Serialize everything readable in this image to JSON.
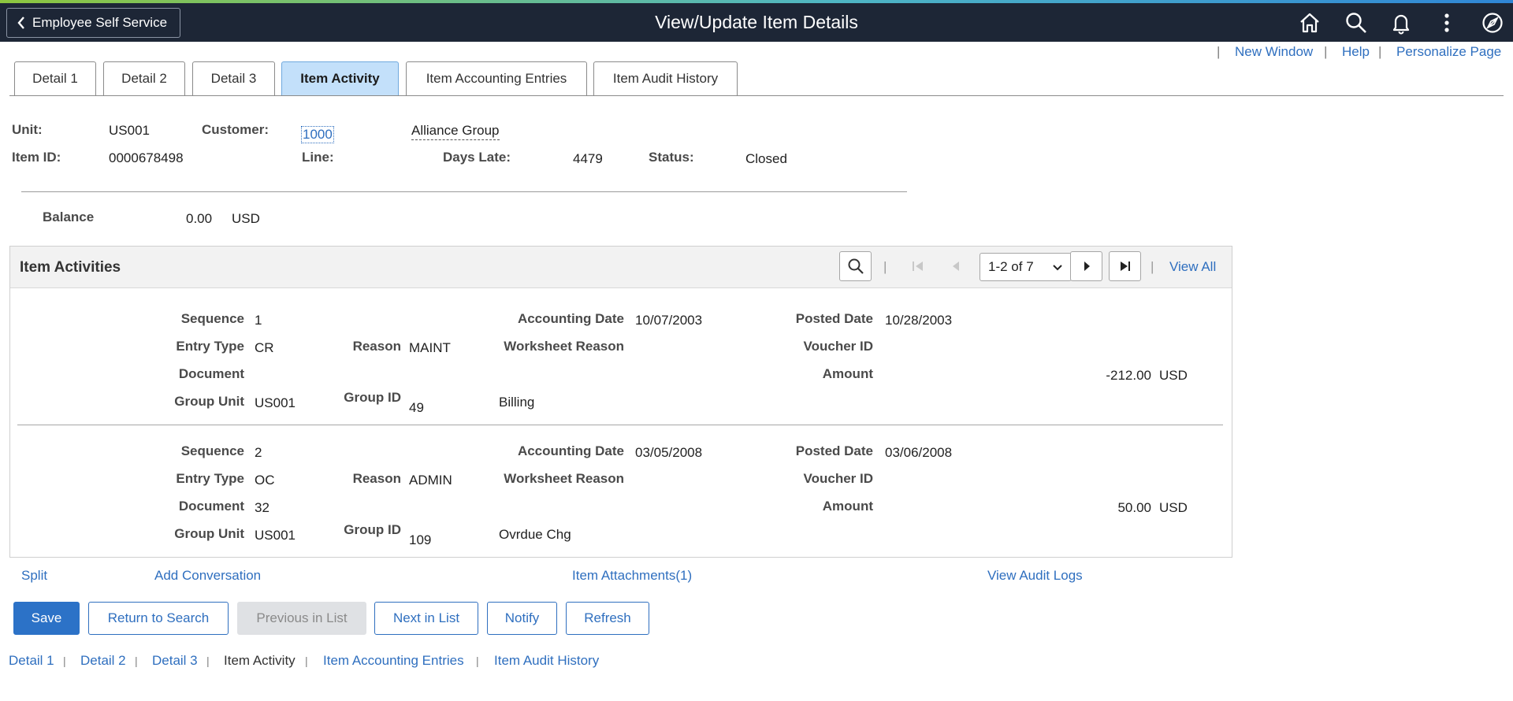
{
  "header": {
    "back_label": "Employee Self Service",
    "title": "View/Update Item Details",
    "icons": [
      "home-icon",
      "search-icon",
      "bell-icon",
      "more-icon",
      "navigator-icon"
    ]
  },
  "utility_links": {
    "new_window": "New Window",
    "help": "Help",
    "personalize": "Personalize Page",
    "separator": "|"
  },
  "tabs": [
    {
      "label": "Detail 1"
    },
    {
      "label": "Detail 2"
    },
    {
      "label": "Detail 3"
    },
    {
      "label": "Item Activity",
      "active": true
    },
    {
      "label": "Item Accounting Entries"
    },
    {
      "label": "Item Audit History"
    }
  ],
  "item": {
    "unit_label": "Unit:",
    "unit": "US001",
    "customer_label": "Customer:",
    "customer_id": "1000",
    "customer_name": "Alliance Group",
    "item_id_label": "Item ID:",
    "item_id": "0000678498",
    "line_label": "Line:",
    "days_late_label": "Days Late:",
    "days_late": "4479",
    "status_label": "Status:",
    "status": "Closed",
    "balance_label": "Balance",
    "balance": "0.00",
    "balance_currency": "USD"
  },
  "activities": {
    "title": "Item Activities",
    "pager": "1-2 of 7",
    "view_all": "View All",
    "labels": {
      "sequence": "Sequence",
      "entry_type": "Entry Type",
      "document": "Document",
      "group_unit": "Group Unit",
      "reason": "Reason",
      "group_id": "Group ID",
      "accounting_date": "Accounting Date",
      "worksheet_reason": "Worksheet Reason",
      "posted_date": "Posted Date",
      "voucher_id": "Voucher ID",
      "amount": "Amount"
    },
    "rows": [
      {
        "sequence": "1",
        "entry_type": "CR",
        "reason": "MAINT",
        "document": "",
        "group_unit": "US001",
        "group_id": "49",
        "group_desc": "Billing",
        "accounting_date": "10/07/2003",
        "posted_date": "10/28/2003",
        "amount": "-212.00",
        "currency": "USD"
      },
      {
        "sequence": "2",
        "entry_type": "OC",
        "reason": "ADMIN",
        "document": "32",
        "group_unit": "US001",
        "group_id": "109",
        "group_desc": "Ovrdue Chg",
        "accounting_date": "03/05/2008",
        "posted_date": "03/06/2008",
        "amount": "50.00",
        "currency": "USD"
      }
    ]
  },
  "actions": {
    "split": "Split",
    "add_conversation": "Add Conversation",
    "item_attachments": "Item Attachments(1)",
    "view_audit_logs": "View Audit Logs"
  },
  "buttons": {
    "save": "Save",
    "return_to_search": "Return to Search",
    "previous_in_list": "Previous in List",
    "next_in_list": "Next in List",
    "notify": "Notify",
    "refresh": "Refresh"
  },
  "footer_links": [
    {
      "label": "Detail 1"
    },
    {
      "label": "Detail 2"
    },
    {
      "label": "Detail 3"
    },
    {
      "label": "Item Activity",
      "current": true
    },
    {
      "label": "Item Accounting Entries"
    },
    {
      "label": "Item Audit History"
    }
  ],
  "colors": {
    "header_bg": "#1d2636",
    "link": "#2f6fbf",
    "primary": "#2c72c7",
    "active_tab": "#c3e0fa"
  }
}
